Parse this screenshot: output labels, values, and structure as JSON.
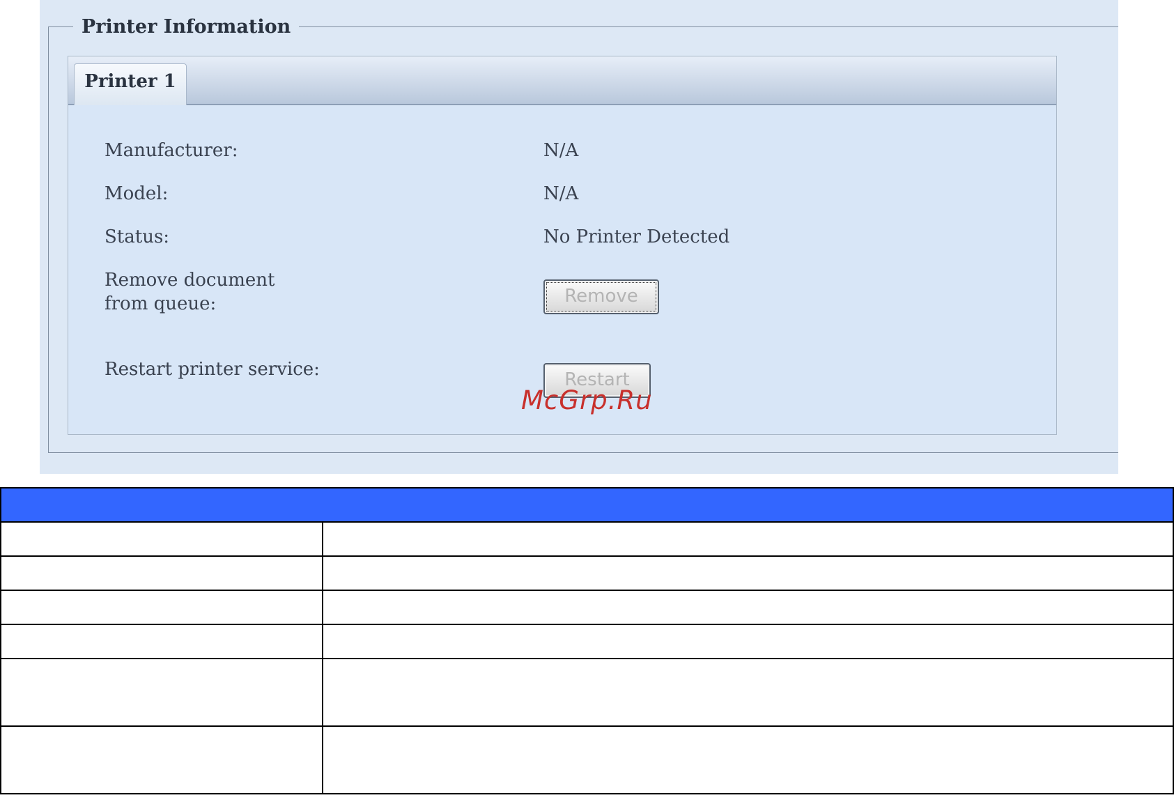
{
  "section": {
    "legend": "Printer Information"
  },
  "tabs": [
    {
      "label": "Printer 1",
      "active": true
    }
  ],
  "rows": {
    "manufacturer": {
      "label": "Manufacturer:",
      "value": "N/A"
    },
    "model": {
      "label": "Model:",
      "value": "N/A"
    },
    "status": {
      "label": "Status:",
      "value": "No Printer Detected"
    },
    "remove": {
      "label_line1": "Remove document",
      "label_line2": "from queue:",
      "button": "Remove"
    },
    "restart": {
      "label": "Restart printer service:",
      "button": "Restart"
    }
  },
  "watermark": "McGrp.Ru",
  "colors": {
    "panel_bg": "#dde8f5",
    "table_header": "#3366ff",
    "watermark": "#c8302c"
  }
}
